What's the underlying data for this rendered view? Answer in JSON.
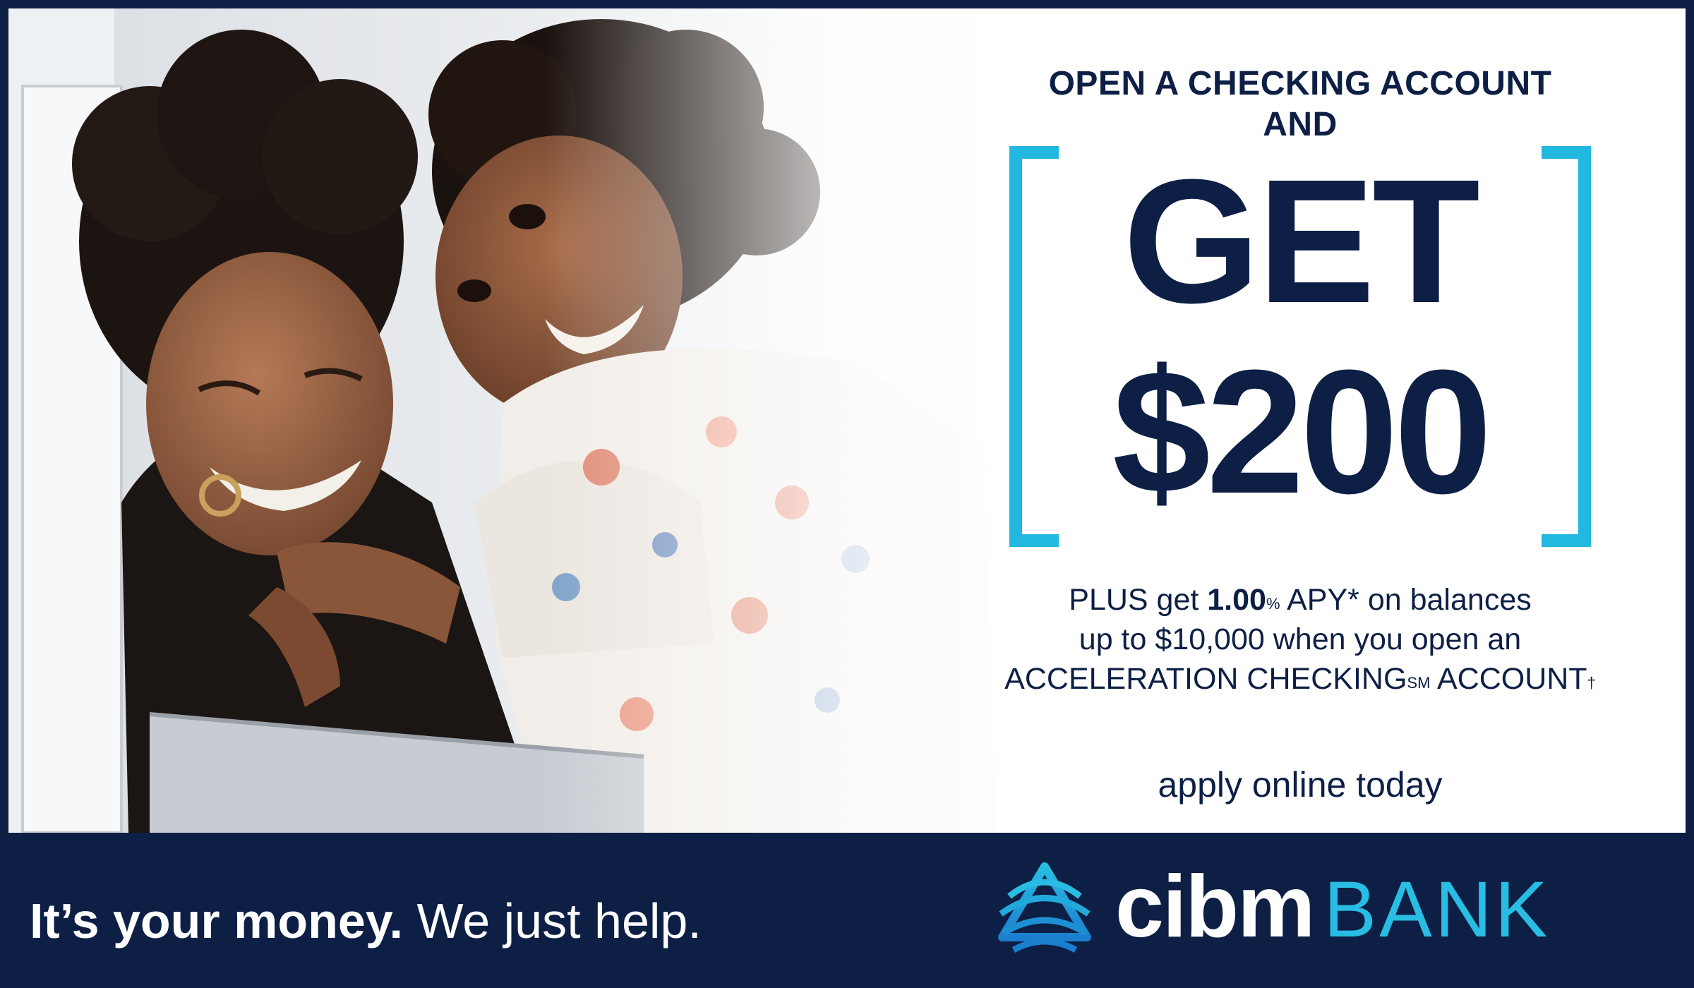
{
  "headline": {
    "line1": "OPEN A CHECKING ACCOUNT",
    "line2": "AND"
  },
  "offer": {
    "get": "GET",
    "amount": "$200"
  },
  "details": {
    "line1_pre": "PLUS get ",
    "rate": "1.00",
    "rate_sup": "%",
    "line1_post": " APY* on balances",
    "line2": "up to $10,000 when you open an",
    "line3_pre": "ACCELERATION CHECKING",
    "line3_sup": "SM",
    "line3_post": " ACCOUNT",
    "line3_mark": "†"
  },
  "cta": "apply online today",
  "footer": {
    "tagline_bold": "It’s your money.",
    "tagline_rest": " We just help."
  },
  "logo": {
    "name": "cibm",
    "suffix": "BANK"
  },
  "colors": {
    "navy": "#0d1f45",
    "accent": "#22b8e0",
    "background": "#ffffff"
  },
  "image": {
    "subject": "photo-mother-and-daughter-hug"
  }
}
